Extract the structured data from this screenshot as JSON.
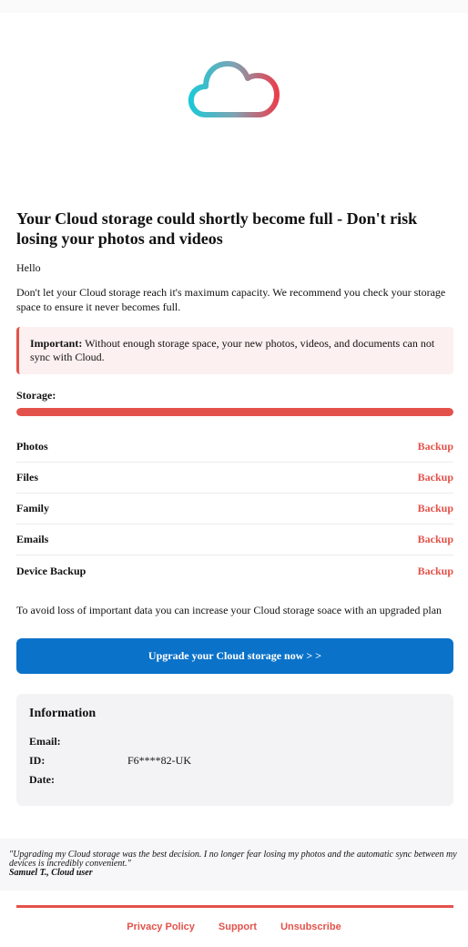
{
  "logo": {
    "icon": "cloud-icon",
    "gradient_start": "#1ec8d6",
    "gradient_end": "#e8404f"
  },
  "headline": "Your Cloud storage could shortly become full - Don't risk losing your photos and videos",
  "greeting": "Hello",
  "intro": "Don't let your Cloud storage reach it's maximum capacity. We recommend you check your storage space to ensure it never becomes full.",
  "alert": {
    "label": "Important:",
    "text": " Without enough storage space, your new photos, videos, and documents can not sync with Cloud."
  },
  "storage": {
    "label": "Storage:",
    "fill_percent": 100
  },
  "categories": [
    {
      "name": "Photos",
      "action": "Backup"
    },
    {
      "name": "Files",
      "action": "Backup"
    },
    {
      "name": "Family",
      "action": "Backup"
    },
    {
      "name": "Emails",
      "action": "Backup"
    },
    {
      "name": "Device Backup",
      "action": "Backup"
    }
  ],
  "avoid_text": "To avoid loss of important data you can increase your Cloud storage soace with an upgraded plan",
  "cta_label": "Upgrade your Cloud storage now > >",
  "info": {
    "title": "Information",
    "rows": [
      {
        "key": "Email:",
        "value": ""
      },
      {
        "key": "ID:",
        "value": "F6****82-UK"
      },
      {
        "key": "Date:",
        "value": ""
      }
    ]
  },
  "testimonial": {
    "quote": "\"Upgrading my Cloud storage was the best decision. I no longer fear losing my photos and the automatic sync between my devices is incredibly convenient.\"",
    "author": "Samuel T., Cloud user"
  },
  "footer": {
    "privacy": "Privacy Policy",
    "support": "Support",
    "unsubscribe": "Unsubscribe"
  },
  "colors": {
    "accent": "#e3524a",
    "primary": "#0a72c9"
  }
}
